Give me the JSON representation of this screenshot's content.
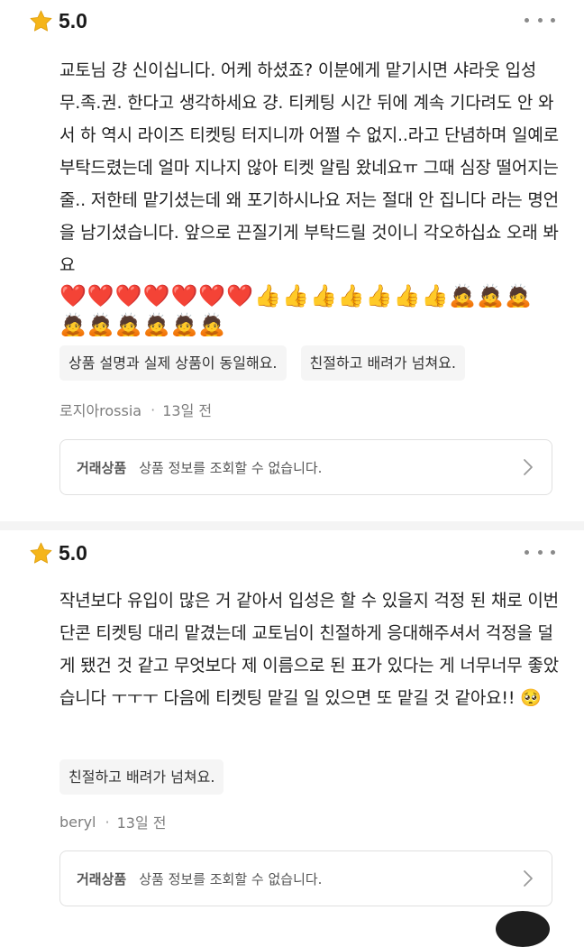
{
  "reviews": [
    {
      "rating": "5.0",
      "text": "교토님 걍 신이십니다. 어케 하셨죠? 이분에게 맡기시면 샤라웃 입성 무.족.권. 한다고 생각하세요 걍. 티케팅 시간 뒤에 계속 기다려도 안 와서 하 역시 라이즈 티켓팅 터지니까 어쩔 수 없지..라고 단념하며 일예로 부탁드렸는데 얼마 지나지 않아 티켓 알림 왔네요ㅠ 그때 심장 떨어지는 줄.. 저한테 맡기셨는데 왜 포기하시나요 저는 절대 안 집니다 라는 명언을 남기셨습니다. 앞으로 끈질기게 부탁드릴 것이니 각오하십쇼 오래 봐요",
      "emoji_line_1": "❤️❤️❤️❤️❤️❤️❤️👍👍👍👍👍👍👍🙇🙇🙇",
      "emoji_line_2": "🙇🙇🙇🙇🙇🙇",
      "tags": [
        "상품 설명과 실제 상품이 동일해요.",
        "친절하고 배려가 넘쳐요."
      ],
      "author": "로지아rossia",
      "time": "13일 전",
      "product_label": "거래상품",
      "product_text": "상품 정보를 조회할 수 없습니다."
    },
    {
      "rating": "5.0",
      "text": "작년보다 유입이 많은 거 같아서 입성은 할 수 있을지 걱정 된 채로 이번 단콘 티켓팅 대리 맡겼는데 교토님이 친절하게 응대해주셔서 걱정을 덜게 됐건 것 같고 무엇보다 제 이름으로 된 표가 있다는 게 너무너무 좋았습니다 ㅜㅜㅜ 다음에 티켓팅 맡길 일 있으면 또 맡길 것 같아요!! 🥺",
      "tags": [
        "친절하고 배려가 넘쳐요."
      ],
      "author": "beryl",
      "time": "13일 전",
      "product_label": "거래상품",
      "product_text": "상품 정보를 조회할 수 없습니다."
    }
  ],
  "icons": {
    "star": "star-icon",
    "more": "more-dots-icon",
    "chevron": "chevron-right-icon"
  },
  "colors": {
    "star": "#f5b51a",
    "tag_bg": "#f5f5f5",
    "meta": "#7d7d7d",
    "border": "#e0e0e0"
  }
}
